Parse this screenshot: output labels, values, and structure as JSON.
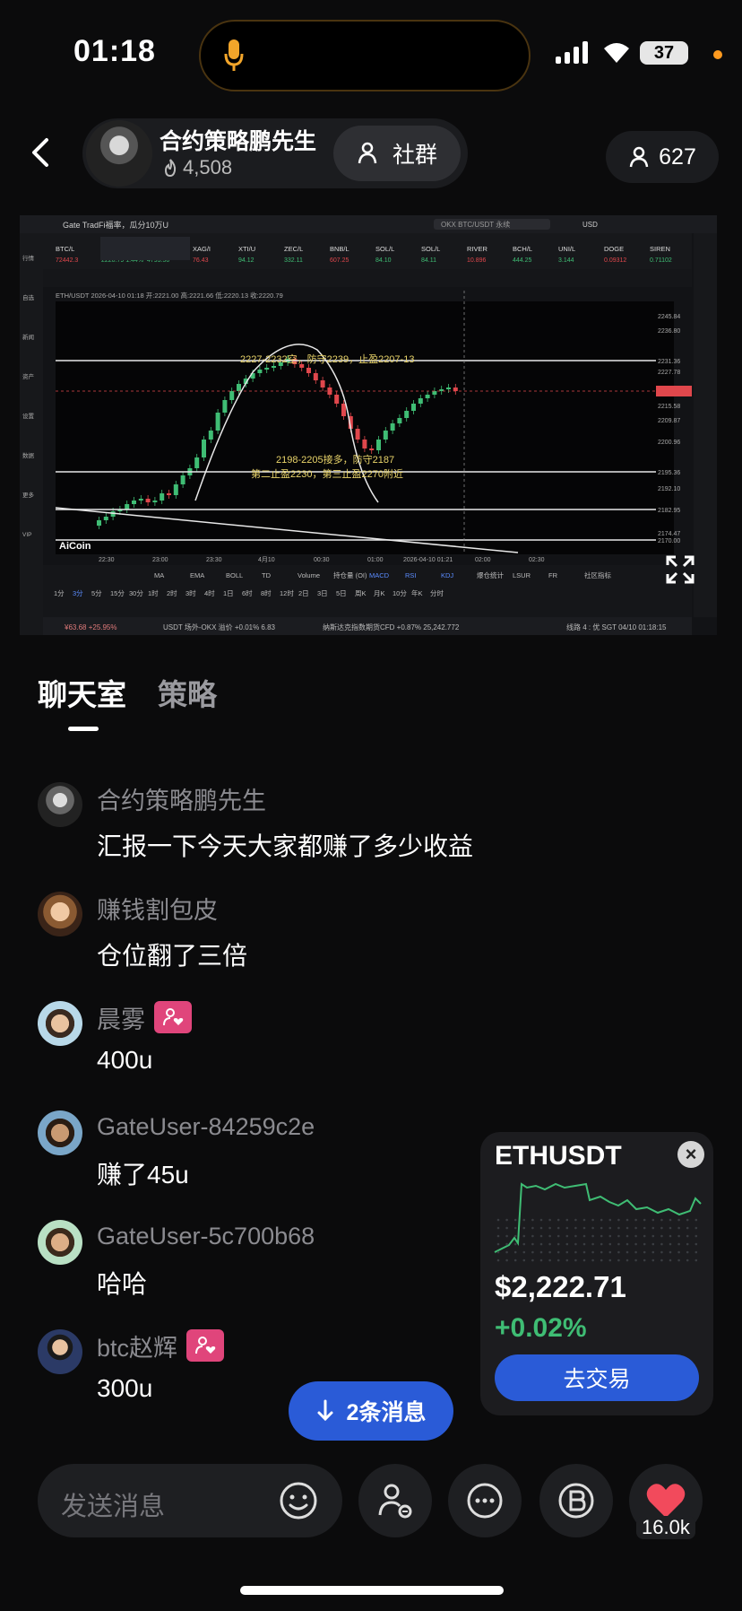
{
  "status_bar": {
    "time": "01:18",
    "battery": "37"
  },
  "header": {
    "host_name": "合约策略鹏先生",
    "host_likes": "4,508",
    "group_label": "社群",
    "viewer_count": "627"
  },
  "video": {
    "app_header": "Gate TradFi福率，瓜分10万U",
    "tickers": [
      "BTC/L",
      "ETH/USDT永续",
      "XAU/I",
      "XAG/I",
      "XTI/U",
      "ZEC/L",
      "BNB/L",
      "SOL/L",
      "SOL/L",
      "RIVER",
      "BCH/L",
      "UNI/L",
      "DOGE",
      "SIREN"
    ],
    "ticker_prices": [
      "72442.3",
      "2220.79 1.44%",
      "4793.50",
      "76.43",
      "94.12",
      "332.11",
      "607.25",
      "84.10",
      "84.11",
      "10.896",
      "444.25",
      "3.144",
      "0.09312",
      "0.71102"
    ],
    "search": "OKX BTC/USDT 永续",
    "currency": "USD",
    "pair_info": "ETH/USDT 2026-04-10 01:18 开:2221.00 高:2221.66 低:2220.13 收:2220.79",
    "annotation_top": "2227-2232空，防守2239，止盈2207-13",
    "annotation_mid": "2198-2205接多，防守2187",
    "annotation_mid2": "第二止盈2230，第三止盈2270附近",
    "price_labels": [
      "2245.84",
      "2236.80",
      "2231.36",
      "2227.78",
      "2220.79",
      "2215.58",
      "2209.87",
      "2200.96",
      "2195.36",
      "2192.10",
      "2182.95",
      "2174.47",
      "2170.00"
    ],
    "time_labels": [
      "22:30",
      "23:00",
      "23:30",
      "4月10",
      "00:30",
      "01:00",
      "2026-04-10 01:21",
      "02:00",
      "02:30"
    ],
    "indicators": [
      "MA",
      "EMA",
      "BOLL",
      "TD",
      "Volume",
      "持仓量 (OI)",
      "MACD",
      "RSI",
      "KDJ",
      "爆仓统计",
      "LSUR",
      "FR",
      "社区指标"
    ],
    "intervals": [
      "1分",
      "3分",
      "5分",
      "15分",
      "30分",
      "1时",
      "2时",
      "3时",
      "4时",
      "1日",
      "6时",
      "8时",
      "12时",
      "2日",
      "3日",
      "5日",
      "周K",
      "月K",
      "10分",
      "年K",
      "分时"
    ],
    "brand": "AiCoin",
    "footer_left": "¥63.68 +25.95%",
    "footer_mid": "USDT 场外-OKX 溢价 +0.01% 6.83",
    "footer_mid2": "纳斯达克指数期货CFD +0.87% 25,242.772",
    "footer_right": "线路 4 : 优  SGT 04/10 01:18:15",
    "sidebar": [
      "行情",
      "自选",
      "新闻",
      "资产",
      "设置",
      "数据",
      "更多",
      "VIP"
    ]
  },
  "tabs": {
    "chat": "聊天室",
    "strategy": "策略"
  },
  "messages": [
    {
      "user": "合约策略鹏先生",
      "text": "汇报一下今天大家都赚了多少收益",
      "badge": false
    },
    {
      "user": "赚钱割包皮",
      "text": "仓位翻了三倍",
      "badge": false
    },
    {
      "user": "晨雾",
      "text": "400u",
      "badge": true
    },
    {
      "user": "GateUser-84259c2e",
      "text": "赚了45u",
      "badge": false
    },
    {
      "user": "GateUser-5c700b68",
      "text": "哈哈",
      "badge": false
    },
    {
      "user": "btc赵辉",
      "text": "300u",
      "badge": true
    }
  ],
  "ticker_card": {
    "symbol": "ETHUSDT",
    "price": "$2,222.71",
    "change": "+0.02%",
    "trade_label": "去交易"
  },
  "new_messages": "2条消息",
  "input": {
    "placeholder": "发送消息"
  },
  "like_count": "16.0k",
  "colors": {
    "accent_blue": "#2a5bd7",
    "up_green": "#3fbd74",
    "down_red": "#e0474c",
    "badge_pink": "#e0457b"
  }
}
